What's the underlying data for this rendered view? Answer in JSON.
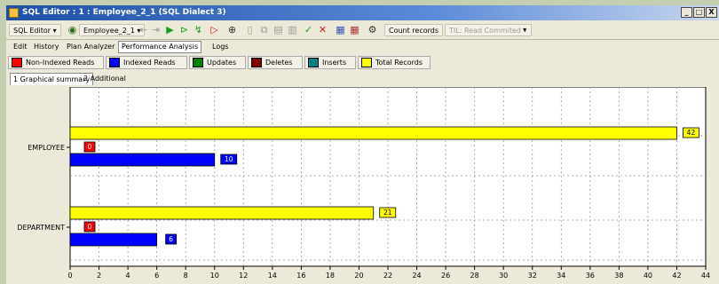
{
  "window": {
    "title": "SQL Editor : 1 : Employee_2_1 (SQL Dialect 3)",
    "controls": [
      "_",
      "□",
      "X"
    ]
  },
  "toolbar": {
    "sql_editor": "SQL Editor ▾",
    "connection": "Employee_2_1 ▾",
    "count_records": "Count records",
    "til": "TIL: Read Commited ▾",
    "extra": "▾"
  },
  "tabs": [
    "Edit",
    "History",
    "Plan Analyzer",
    "Performance Analysis",
    "Logs"
  ],
  "active_tab": "Performance Analysis",
  "legend": [
    {
      "label": "Non-Indexed Reads",
      "color": "#ff0000"
    },
    {
      "label": "Indexed Reads",
      "color": "#0000ff"
    },
    {
      "label": "Updates",
      "color": "#008000"
    },
    {
      "label": "Deletes",
      "color": "#800000"
    },
    {
      "label": "Inserts",
      "color": "#008080"
    },
    {
      "label": "Total Records",
      "color": "#ffff00"
    }
  ],
  "subtabs": [
    "1 Graphical summary",
    "2 Additional"
  ],
  "chart_data": {
    "type": "bar",
    "orientation": "horizontal",
    "categories": [
      "EMPLOYEE",
      "DEPARTMENT"
    ],
    "series": [
      {
        "name": "Total Records",
        "color": "#ffff00",
        "values": [
          42,
          21
        ]
      },
      {
        "name": "Non-Indexed Reads",
        "color": "#ff0000",
        "values": [
          0,
          0
        ]
      },
      {
        "name": "Indexed Reads",
        "color": "#0000ff",
        "values": [
          10,
          6
        ]
      }
    ],
    "xlim": [
      0,
      44
    ],
    "xticks": [
      0,
      2,
      4,
      6,
      8,
      10,
      12,
      14,
      16,
      18,
      20,
      22,
      24,
      26,
      28,
      30,
      32,
      34,
      36,
      38,
      40,
      42,
      44
    ],
    "grid": true
  }
}
